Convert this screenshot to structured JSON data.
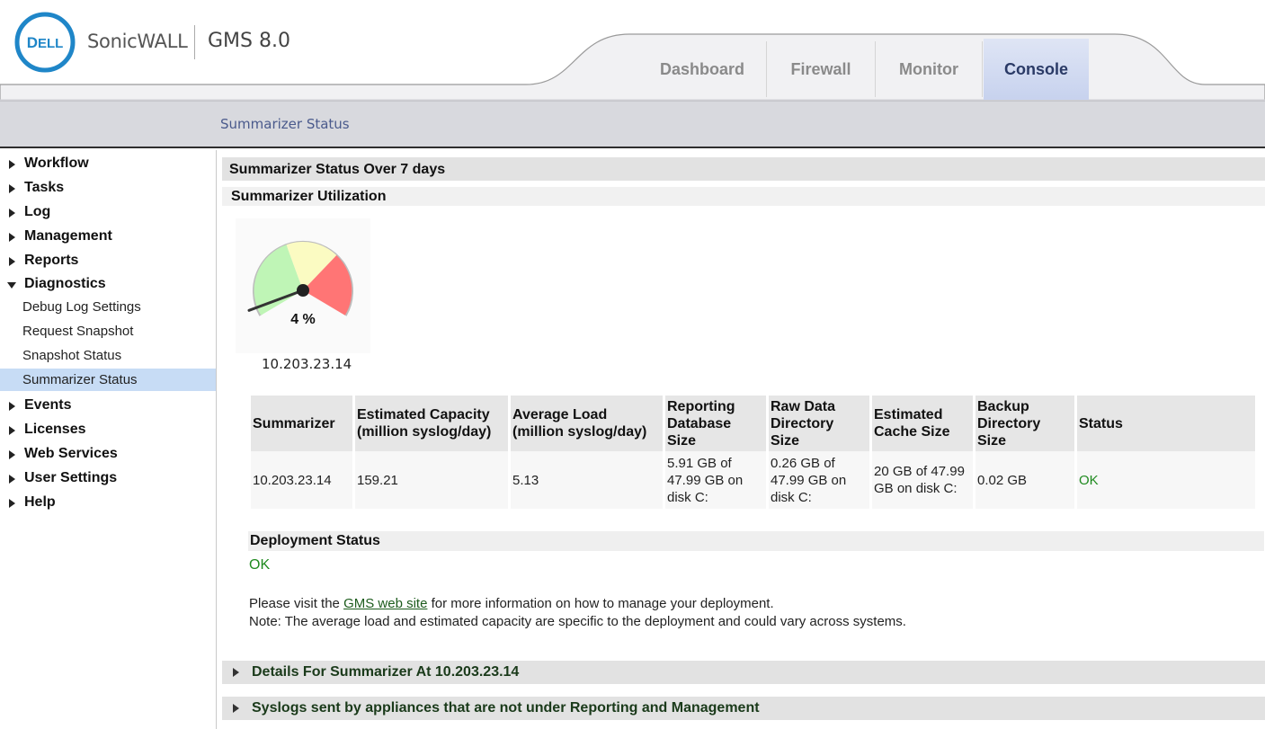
{
  "header": {
    "brand": "SonicWALL",
    "product": "GMS 8.0",
    "tabs": [
      {
        "label": "Dashboard"
      },
      {
        "label": "Firewall"
      },
      {
        "label": "Monitor"
      },
      {
        "label": "Console"
      }
    ],
    "active_tab": "Console"
  },
  "subbar": {
    "title": "Summarizer Status"
  },
  "sidebar": {
    "items": [
      {
        "label": "Workflow"
      },
      {
        "label": "Tasks"
      },
      {
        "label": "Log"
      },
      {
        "label": "Management"
      },
      {
        "label": "Reports"
      },
      {
        "label": "Diagnostics",
        "expanded": true
      },
      {
        "label": "Events"
      },
      {
        "label": "Licenses"
      },
      {
        "label": "Web Services"
      },
      {
        "label": "User Settings"
      },
      {
        "label": "Help"
      }
    ],
    "diagnostics_children": [
      {
        "label": "Debug Log Settings"
      },
      {
        "label": "Request Snapshot"
      },
      {
        "label": "Snapshot Status"
      },
      {
        "label": "Summarizer Status",
        "active": true
      }
    ]
  },
  "main": {
    "section_title": "Summarizer Status Over 7 days",
    "utilization_title": "Summarizer Utilization",
    "gauge": {
      "value_label": "4 %",
      "value_percent": 4,
      "host": "10.203.23.14"
    },
    "table": {
      "headers": {
        "summarizer": "Summarizer",
        "capacity": [
          "Estimated Capacity",
          "(million syslog/day)"
        ],
        "load": [
          "Average Load",
          "(million syslog/day)"
        ],
        "reporting": [
          "Reporting",
          "Database",
          "Size"
        ],
        "raw": [
          "Raw Data",
          "Directory",
          "Size"
        ],
        "cache": [
          "Estimated",
          "Cache Size"
        ],
        "backup": [
          "Backup",
          "Directory",
          "Size"
        ],
        "status": "Status"
      },
      "row": {
        "summarizer": "10.203.23.14",
        "capacity": "159.21",
        "load": "5.13",
        "reporting": [
          "5.91 GB of",
          "47.99 GB on",
          "disk C:"
        ],
        "raw": [
          "0.26 GB of",
          "47.99 GB on",
          "disk C:"
        ],
        "cache": [
          "20 GB of 47.99",
          "GB on disk C:"
        ],
        "backup": "0.02 GB",
        "status": "OK"
      }
    },
    "deployment": {
      "title": "Deployment Status",
      "status": "OK",
      "info_prefix": "Please visit the ",
      "info_link": "GMS web site",
      "info_suffix": " for more information on how to manage your deployment.",
      "note": "Note: The average load and estimated capacity are specific to the deployment and could vary across systems."
    },
    "details_band": "Details For Summarizer At 10.203.23.14",
    "syslog_band": "Syslogs sent by appliances that are not under Reporting and Management"
  },
  "colors": {
    "ok": "#1f8a1f",
    "active_tab": "#c7d2ee",
    "active_nav": "#c7dcf5"
  }
}
